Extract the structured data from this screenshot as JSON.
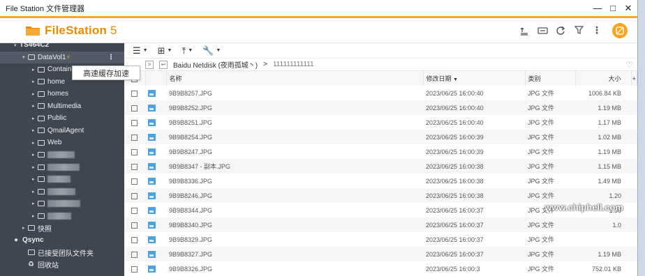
{
  "window": {
    "title": "File Station 文件管理器"
  },
  "app": {
    "brand": "FileStation",
    "version": "5"
  },
  "sidebar": {
    "nas": "TS464C2",
    "volume": "DataVol1",
    "items": [
      {
        "label": "Container",
        "blur": false
      },
      {
        "label": "home",
        "blur": false
      },
      {
        "label": "homes",
        "blur": false
      },
      {
        "label": "Multimedia",
        "blur": false
      },
      {
        "label": "Public",
        "blur": false
      },
      {
        "label": "QmailAgent",
        "blur": false
      },
      {
        "label": "Web",
        "blur": false
      },
      {
        "label": "",
        "blur": true
      },
      {
        "label": "",
        "blur": true
      },
      {
        "label": "",
        "blur": true
      },
      {
        "label": "",
        "blur": true
      },
      {
        "label": "",
        "blur": true
      },
      {
        "label": "",
        "blur": true
      }
    ],
    "snapshot": "快照",
    "qsync": "Qsync",
    "shared_team": "已接受团队文件夹",
    "recycle": "回收站"
  },
  "tooltip": "高速缓存加速",
  "path": {
    "root": "Baidu Netdisk (夜雨孤城丶)",
    "sub": "111111111111"
  },
  "table": {
    "headers": {
      "name": "名称",
      "date": "修改日期",
      "type": "类别",
      "size": "大小"
    },
    "rows": [
      {
        "name": "9B9B8257.JPG",
        "date": "2023/06/25 16:00:40",
        "type": "JPG 文件",
        "size": "1006.84 KB"
      },
      {
        "name": "9B9B8252.JPG",
        "date": "2023/06/25 16:00:40",
        "type": "JPG 文件",
        "size": "1.19 MB"
      },
      {
        "name": "9B9B8251.JPG",
        "date": "2023/06/25 16:00:40",
        "type": "JPG 文件",
        "size": "1.17 MB"
      },
      {
        "name": "9B9B8254.JPG",
        "date": "2023/06/25 16:00:39",
        "type": "JPG 文件",
        "size": "1.02 MB"
      },
      {
        "name": "9B9B8247.JPG",
        "date": "2023/06/25 16:00:39",
        "type": "JPG 文件",
        "size": "1.19 MB"
      },
      {
        "name": "9B9B8347 - 副本.JPG",
        "date": "2023/06/25 16:00:38",
        "type": "JPG 文件",
        "size": "1.15 MB"
      },
      {
        "name": "9B9B8336.JPG",
        "date": "2023/06/25 16:00:38",
        "type": "JPG 文件",
        "size": "1.49 MB"
      },
      {
        "name": "9B9B8246.JPG",
        "date": "2023/06/25 16:00:38",
        "type": "JPG 文件",
        "size": "1.20"
      },
      {
        "name": "9B9B8344.JPG",
        "date": "2023/06/25 16:00:37",
        "type": "JPG 文件",
        "size": "1.36"
      },
      {
        "name": "9B9B8340.JPG",
        "date": "2023/06/25 16:00:37",
        "type": "JPG 文件",
        "size": "1.0"
      },
      {
        "name": "9B9B8329.JPG",
        "date": "2023/06/25 16:00:37",
        "type": "JPG 文件",
        "size": ""
      },
      {
        "name": "9B9B8327.JPG",
        "date": "2023/06/25 16:00:37",
        "type": "JPG 文件",
        "size": "1.19 MB"
      },
      {
        "name": "9B9B8326.JPG",
        "date": "2023/06/25 16:00:3",
        "type": "JPG 文件",
        "size": "752.01 KB"
      }
    ]
  },
  "watermark": "www.chiphell.com",
  "colors": {
    "accent": "#f5a623",
    "brand": "#f08a00",
    "sidebar": "#3f4652",
    "file_icon": "#4aa3df"
  }
}
